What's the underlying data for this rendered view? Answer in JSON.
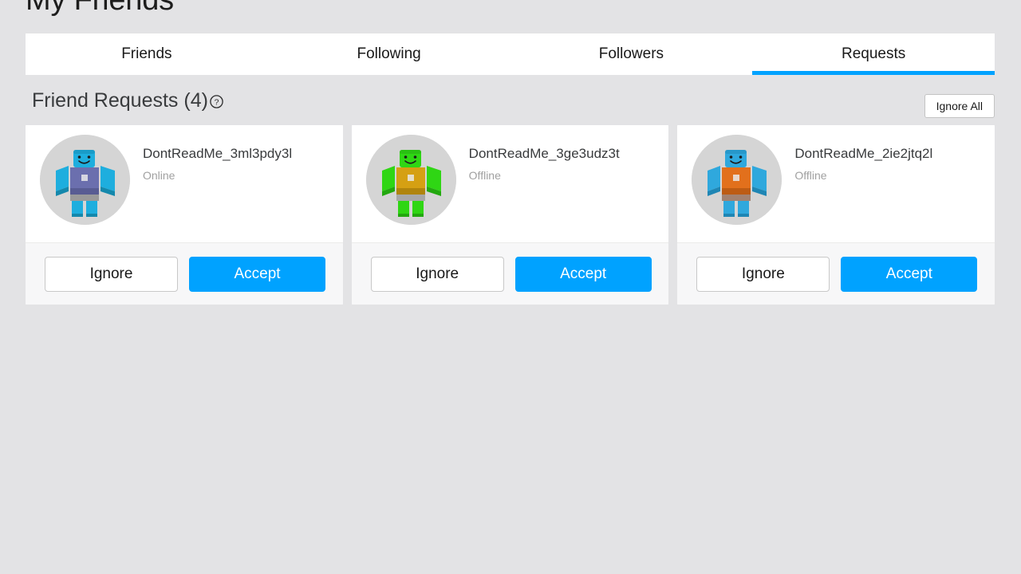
{
  "page": {
    "title": "My Friends",
    "background_color": "#e3e3e5",
    "accent_color": "#00a2ff"
  },
  "tabs": [
    {
      "label": "Friends",
      "active": false
    },
    {
      "label": "Following",
      "active": false
    },
    {
      "label": "Followers",
      "active": false
    },
    {
      "label": "Requests",
      "active": true
    }
  ],
  "section": {
    "title": "Friend Requests (4)",
    "count": 4,
    "help_icon": "question-mark-circle-icon",
    "ignore_all_label": "Ignore All"
  },
  "buttons": {
    "ignore_label": "Ignore",
    "accept_label": "Accept"
  },
  "requests": [
    {
      "username": "DontReadMe_3ml3pdy3l",
      "status": "Online",
      "avatar": {
        "icon": "roblox-avatar-icon",
        "skin": "#1eaede",
        "skin_dark": "#1488ac",
        "torso": "#6b6fae",
        "torso_dark": "#585c93",
        "legs": "#1eaede",
        "belt": "#9a9a9a",
        "background": "#d5d5d5"
      }
    },
    {
      "username": "DontReadMe_3ge3udz3t",
      "status": "Offline",
      "avatar": {
        "icon": "roblox-avatar-icon",
        "skin": "#2fd614",
        "skin_dark": "#23a80f",
        "torso": "#d5a013",
        "torso_dark": "#b0840d",
        "legs": "#2fd614",
        "belt": "#a8a8a8",
        "background": "#d5d5d5"
      }
    },
    {
      "username": "DontReadMe_2ie2jtq2l",
      "status": "Offline",
      "avatar": {
        "icon": "roblox-avatar-icon",
        "skin": "#2fa8dd",
        "skin_dark": "#1f86b4",
        "torso": "#e2701c",
        "torso_dark": "#bd5c14",
        "legs": "#2fa8dd",
        "belt": "#a38270",
        "background": "#d5d5d5"
      }
    }
  ]
}
